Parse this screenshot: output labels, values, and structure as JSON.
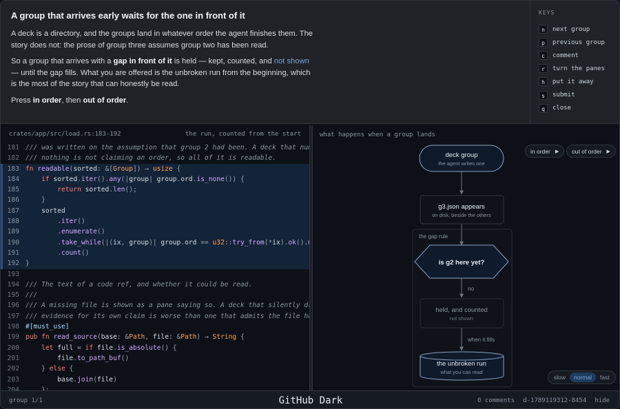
{
  "prose": {
    "title": "A group that arrives early waits for the one in front of it",
    "p1": "A deck is a directory, and the groups land in whatever order the agent finishes them. The story does not: the prose of group three assumes group two has been read.",
    "p2_a": "So a group that arrives with a ",
    "p2_b": "gap in front of it",
    "p2_c": " is held — kept, counted, and ",
    "p2_d": "not shown",
    "p2_e": " — until the gap fills. What you are offered is the unbroken run from the beginning, which is the most of the story that can honestly be read.",
    "p3_a": "Press ",
    "p3_b": "in order",
    "p3_c": ", then ",
    "p3_d": "out of order",
    "p3_e": "."
  },
  "keys": {
    "title": "KEYS",
    "items": [
      {
        "key": "n",
        "label": "next group"
      },
      {
        "key": "p",
        "label": "previous group"
      },
      {
        "key": "c",
        "label": "comment"
      },
      {
        "key": "r",
        "label": "turn the panes"
      },
      {
        "key": "h",
        "label": "put it away"
      },
      {
        "key": "s",
        "label": "submit"
      },
      {
        "key": "q",
        "label": "close"
      }
    ]
  },
  "code": {
    "path": "crates/app/src/load.rs:183-192",
    "caption": "the run, counted from the start",
    "lines": [
      {
        "n": "181",
        "hl": false,
        "t": [
          [
            "cm",
            "/// was written on the assumption that group 2 had been. A deck that num"
          ]
        ]
      },
      {
        "n": "182",
        "hl": false,
        "t": [
          [
            "cm",
            "/// nothing is not claiming an order, so all of it is readable."
          ]
        ]
      },
      {
        "n": "183",
        "hl": true,
        "t": [
          [
            "kw",
            "fn "
          ],
          [
            "fn",
            "readable"
          ],
          [
            "pu",
            "("
          ],
          [
            "ct",
            "sorted"
          ],
          [
            "pu",
            ": &["
          ],
          [
            "ty",
            "Group"
          ],
          [
            "pu",
            "]) → "
          ],
          [
            "ty",
            "usize"
          ],
          [
            "pu",
            " {"
          ]
        ]
      },
      {
        "n": "184",
        "hl": true,
        "t": [
          [
            "ct",
            "    "
          ],
          [
            "kw",
            "if "
          ],
          [
            "ct",
            "sorted"
          ],
          [
            "pu",
            "."
          ],
          [
            "fn",
            "iter"
          ],
          [
            "pu",
            "()."
          ],
          [
            "fn",
            "any"
          ],
          [
            "pu",
            "(|"
          ],
          [
            "ct",
            "group"
          ],
          [
            "pu",
            "| "
          ],
          [
            "ct",
            "group"
          ],
          [
            "pu",
            "."
          ],
          [
            "ct",
            "ord"
          ],
          [
            "pu",
            "."
          ],
          [
            "fn",
            "is_none"
          ],
          [
            "pu",
            "()) {"
          ]
        ]
      },
      {
        "n": "185",
        "hl": true,
        "t": [
          [
            "ct",
            "        "
          ],
          [
            "kw",
            "return "
          ],
          [
            "ct",
            "sorted"
          ],
          [
            "pu",
            "."
          ],
          [
            "fn",
            "len"
          ],
          [
            "pu",
            "();"
          ]
        ]
      },
      {
        "n": "186",
        "hl": true,
        "t": [
          [
            "pu",
            "    }"
          ]
        ]
      },
      {
        "n": "187",
        "hl": true,
        "t": [
          [
            "ct",
            "    sorted"
          ]
        ]
      },
      {
        "n": "188",
        "hl": true,
        "t": [
          [
            "pu",
            "        ."
          ],
          [
            "fn",
            "iter"
          ],
          [
            "pu",
            "()"
          ]
        ]
      },
      {
        "n": "189",
        "hl": true,
        "t": [
          [
            "pu",
            "        ."
          ],
          [
            "fn",
            "enumerate"
          ],
          [
            "pu",
            "()"
          ]
        ]
      },
      {
        "n": "190",
        "hl": true,
        "t": [
          [
            "pu",
            "        ."
          ],
          [
            "fn",
            "take_while"
          ],
          [
            "pu",
            "(|("
          ],
          [
            "ct",
            "ix"
          ],
          [
            "pu",
            ", "
          ],
          [
            "ct",
            "group"
          ],
          [
            "pu",
            ")| "
          ],
          [
            "ct",
            "group"
          ],
          [
            "pu",
            "."
          ],
          [
            "ct",
            "ord "
          ],
          [
            "pu",
            "== "
          ],
          [
            "ty",
            "u32"
          ],
          [
            "pu",
            "::"
          ],
          [
            "fn",
            "try_from"
          ],
          [
            "pu",
            "(*"
          ],
          [
            "ct",
            "ix"
          ],
          [
            "pu",
            ")."
          ],
          [
            "fn",
            "ok"
          ],
          [
            "pu",
            "()."
          ],
          [
            "fn",
            "m"
          ]
        ]
      },
      {
        "n": "191",
        "hl": true,
        "t": [
          [
            "pu",
            "        ."
          ],
          [
            "fn",
            "count"
          ],
          [
            "pu",
            "()"
          ]
        ]
      },
      {
        "n": "192",
        "hl": true,
        "t": [
          [
            "pu",
            "}"
          ]
        ]
      },
      {
        "n": "193",
        "hl": false,
        "t": [
          [
            "ct",
            ""
          ]
        ]
      },
      {
        "n": "194",
        "hl": false,
        "t": [
          [
            "cm",
            "/// The text of a code ref, and whether it could be read."
          ]
        ]
      },
      {
        "n": "195",
        "hl": false,
        "t": [
          [
            "cm",
            "///"
          ]
        ]
      },
      {
        "n": "196",
        "hl": false,
        "t": [
          [
            "cm",
            "/// A missing file is shown as a pane saying so. A deck that silently dr"
          ]
        ]
      },
      {
        "n": "197",
        "hl": false,
        "t": [
          [
            "cm",
            "/// evidence for its own claim is worse than one that admits the file ha"
          ]
        ]
      },
      {
        "n": "198",
        "hl": false,
        "t": [
          [
            "ac",
            "#[must_use]"
          ]
        ]
      },
      {
        "n": "199",
        "hl": false,
        "t": [
          [
            "kw",
            "pub fn "
          ],
          [
            "fn",
            "read_source"
          ],
          [
            "pu",
            "("
          ],
          [
            "ct",
            "base"
          ],
          [
            "pu",
            ": &"
          ],
          [
            "ty",
            "Path"
          ],
          [
            "pu",
            ", "
          ],
          [
            "ct",
            "file"
          ],
          [
            "pu",
            ": &"
          ],
          [
            "ty",
            "Path"
          ],
          [
            "pu",
            ") → "
          ],
          [
            "ty",
            "String"
          ],
          [
            "pu",
            " {"
          ]
        ]
      },
      {
        "n": "200",
        "hl": false,
        "t": [
          [
            "ct",
            "    "
          ],
          [
            "kw",
            "let "
          ],
          [
            "ct",
            "full "
          ],
          [
            "pu",
            "= "
          ],
          [
            "kw",
            "if "
          ],
          [
            "ct",
            "file"
          ],
          [
            "pu",
            "."
          ],
          [
            "fn",
            "is_absolute"
          ],
          [
            "pu",
            "() {"
          ]
        ]
      },
      {
        "n": "201",
        "hl": false,
        "t": [
          [
            "ct",
            "        file"
          ],
          [
            "pu",
            "."
          ],
          [
            "fn",
            "to_path_buf"
          ],
          [
            "pu",
            "()"
          ]
        ]
      },
      {
        "n": "202",
        "hl": false,
        "t": [
          [
            "pu",
            "    } "
          ],
          [
            "kw",
            "else"
          ],
          [
            "pu",
            " {"
          ]
        ]
      },
      {
        "n": "203",
        "hl": false,
        "t": [
          [
            "ct",
            "        base"
          ],
          [
            "pu",
            "."
          ],
          [
            "fn",
            "join"
          ],
          [
            "pu",
            "("
          ],
          [
            "ct",
            "file"
          ],
          [
            "pu",
            ")"
          ]
        ]
      },
      {
        "n": "204",
        "hl": false,
        "t": [
          [
            "pu",
            "    };"
          ]
        ]
      }
    ]
  },
  "diagram": {
    "header": "what happens when a group lands",
    "in_order": "in order",
    "out_of_order": "out of order",
    "node_deck_title": "deck group",
    "node_deck_sub": "the agent writes one",
    "node_json_title": "g3.json appears",
    "node_json_sub": "on disk, beside the others",
    "region_label": "the gap rule",
    "node_decision": "is g2 here yet?",
    "edge_no": "no",
    "node_held_title": "held, and counted",
    "node_held_sub": "not shown",
    "edge_fills": "when it fills",
    "node_run_title": "the unbroken run",
    "node_run_sub": "what you can read",
    "speed": [
      "slow",
      "normal",
      "fast"
    ],
    "speed_selected": "normal",
    "colors": {
      "active_node": "#0f1a2b",
      "active_stroke": "#8aa3c2",
      "dim_stroke": "#30363d",
      "edge": "#6e7681"
    }
  },
  "status": {
    "group": "group 1/1",
    "theme": "GitHub Dark",
    "comments": "0 comments",
    "deck_id": "d-1789119312-8454",
    "hide": "hide"
  }
}
